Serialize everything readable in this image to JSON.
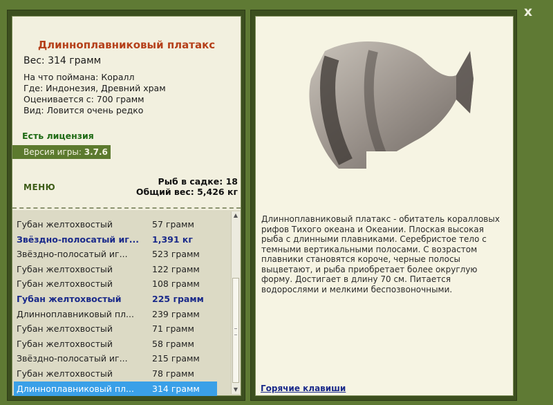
{
  "window": {
    "close_label": "x"
  },
  "fish": {
    "title": "Длинноплавниковый платакс",
    "weight": "Вес: 314 грамм",
    "info": [
      "На что поймана: Коралл",
      "Где: Индонезия, Древний храм",
      "Оценивается с: 700 грамм",
      "Вид: Ловится очень редко"
    ],
    "description": "Длинноплавниковый платакс - обитатель коралловых рифов Тихого океана и Океании. Плоская высокая рыба с длинными плавниками. Серебристое тело с темными вертикальными полосами. С возрастом плавники становятся короче, черные полосы выцветают, и рыба приобретает более округлую форму. Достигает в длину 70 см. Питается водорослями и мелкими беспозвоночными."
  },
  "license": "Есть лицензия",
  "version": {
    "label": "Версия игры:",
    "value": "3.7.6"
  },
  "menu_label": "МЕНЮ",
  "stats": {
    "fish_count": "Рыб в садке: 18",
    "total_weight": "Общий вес: 5,426 кг"
  },
  "catch_list": [
    {
      "name": "Губан желтохвостый",
      "weight": "57 грамм",
      "style": "normal"
    },
    {
      "name": "Звёздно-полосатый иг...",
      "weight": "1,391 кг",
      "style": "bold"
    },
    {
      "name": "Звёздно-полосатый иг...",
      "weight": "523 грамм",
      "style": "normal"
    },
    {
      "name": "Губан желтохвостый",
      "weight": "122 грамм",
      "style": "normal"
    },
    {
      "name": "Губан желтохвостый",
      "weight": "108 грамм",
      "style": "normal"
    },
    {
      "name": "Губан желтохвостый",
      "weight": "225 грамм",
      "style": "bold"
    },
    {
      "name": "Длинноплавниковый пл...",
      "weight": "239 грамм",
      "style": "normal"
    },
    {
      "name": "Губан желтохвостый",
      "weight": "71 грамм",
      "style": "normal"
    },
    {
      "name": "Губан желтохвостый",
      "weight": "58 грамм",
      "style": "normal"
    },
    {
      "name": "Звёздно-полосатый иг...",
      "weight": "215 грамм",
      "style": "normal"
    },
    {
      "name": "Губан желтохвостый",
      "weight": "78 грамм",
      "style": "normal"
    },
    {
      "name": "Длинноплавниковый пл...",
      "weight": "314 грамм",
      "style": "selected"
    }
  ],
  "hotkeys_label": "Горячие клавиши",
  "colors": {
    "frame": "#5f7a34",
    "panel_bg": "#f2f0df",
    "title": "#b5401a",
    "license": "#1e6a14",
    "selected": "#3aa0e8",
    "bold_row": "#1a2a8a"
  }
}
